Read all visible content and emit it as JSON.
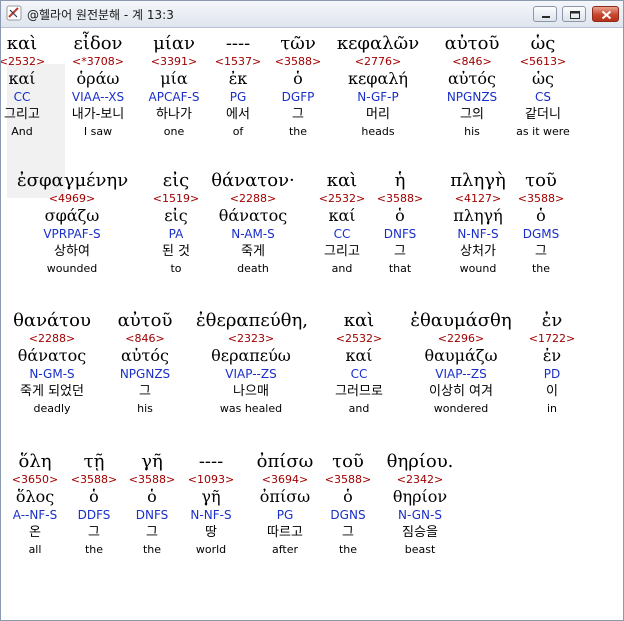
{
  "window": {
    "title": "@헬라어 원전분해 - 계 13:3"
  },
  "lines": [
    {
      "words": [
        {
          "greek": "καὶ",
          "strong": "<2532>",
          "lexeme": "καί",
          "parse": "CC",
          "korean": "그리고",
          "english": "And"
        },
        {
          "greek": "εἶδον",
          "strong": "<*3708>",
          "lexeme": "ὁράω",
          "parse": "VIAA--XS",
          "korean": "내가-보니",
          "english": "I saw"
        },
        {
          "greek": "μίαν",
          "strong": "<3391>",
          "lexeme": "μία",
          "parse": "APCAF-S",
          "korean": "하나가",
          "english": "one"
        },
        {
          "greek": "----",
          "strong": "<1537>",
          "lexeme": "ἐκ",
          "parse": "PG",
          "korean": "에서",
          "english": "of"
        },
        {
          "greek": "τῶν",
          "strong": "<3588>",
          "lexeme": "ὁ",
          "parse": "DGFP",
          "korean": "그",
          "english": "the"
        },
        {
          "greek": "κεφαλῶν",
          "strong": "<2776>",
          "lexeme": "κεφαλή",
          "parse": "N-GF-P",
          "korean": "머리",
          "english": "heads"
        },
        {
          "greek": "αὐτοῦ",
          "strong": "<846>",
          "lexeme": "αὐτός",
          "parse": "NPGNZS",
          "korean": "그의",
          "english": "his"
        },
        {
          "greek": "ὡς",
          "strong": "<5613>",
          "lexeme": "ὡς",
          "parse": "CS",
          "korean": "같더니",
          "english": "as it were"
        }
      ]
    },
    {
      "words": [
        {
          "greek": "ἐσφαγμένην",
          "strong": "<4969>",
          "lexeme": "σφάζω",
          "parse": "VPRPAF-S",
          "korean": "상하여",
          "english": "wounded"
        },
        {
          "greek": "εἰς",
          "strong": "<1519>",
          "lexeme": "εἰς",
          "parse": "PA",
          "korean": "된 것",
          "english": "to"
        },
        {
          "greek": "θάνατον·",
          "strong": "<2288>",
          "lexeme": "θάνατος",
          "parse": "N-AM-S",
          "korean": "죽게",
          "english": "death"
        },
        {
          "greek": "καὶ",
          "strong": "<2532>",
          "lexeme": "καί",
          "parse": "CC",
          "korean": "그리고",
          "english": "and"
        },
        {
          "greek": "ἡ",
          "strong": "<3588>",
          "lexeme": "ὁ",
          "parse": "DNFS",
          "korean": "그",
          "english": "that"
        },
        {
          "greek": "πληγὴ",
          "strong": "<4127>",
          "lexeme": "πληγή",
          "parse": "N-NF-S",
          "korean": "상처가",
          "english": "wound"
        },
        {
          "greek": "τοῦ",
          "strong": "<3588>",
          "lexeme": "ὁ",
          "parse": "DGMS",
          "korean": "그",
          "english": "the"
        }
      ]
    },
    {
      "words": [
        {
          "greek": "θανάτου",
          "strong": "<2288>",
          "lexeme": "θάνατος",
          "parse": "N-GM-S",
          "korean": "죽게 되었던",
          "english": "deadly"
        },
        {
          "greek": "αὐτοῦ",
          "strong": "<846>",
          "lexeme": "αὐτός",
          "parse": "NPGNZS",
          "korean": "그",
          "english": "his"
        },
        {
          "greek": "ἐθεραπεύθη,",
          "strong": "<2323>",
          "lexeme": "θεραπεύω",
          "parse": "VIAP--ZS",
          "korean": "나으매",
          "english": "was healed"
        },
        {
          "greek": "καὶ",
          "strong": "<2532>",
          "lexeme": "καί",
          "parse": "CC",
          "korean": "그러므로",
          "english": "and"
        },
        {
          "greek": "ἐθαυμάσθη",
          "strong": "<2296>",
          "lexeme": "θαυμάζω",
          "parse": "VIAP--ZS",
          "korean": "이상히 여겨",
          "english": "wondered"
        },
        {
          "greek": "ἐν",
          "strong": "<1722>",
          "lexeme": "ἐν",
          "parse": "PD",
          "korean": "이",
          "english": "in"
        }
      ]
    },
    {
      "words": [
        {
          "greek": "ὅλη",
          "strong": "<3650>",
          "lexeme": "ὅλος",
          "parse": "A--NF-S",
          "korean": "온",
          "english": "all"
        },
        {
          "greek": "τῇ",
          "strong": "<3588>",
          "lexeme": "ὁ",
          "parse": "DDFS",
          "korean": "그",
          "english": "the"
        },
        {
          "greek": "γῆ",
          "strong": "<3588>",
          "lexeme": "ὁ",
          "parse": "DNFS",
          "korean": "그",
          "english": "the"
        },
        {
          "greek": "----",
          "strong": "<1093>",
          "lexeme": "γῆ",
          "parse": "N-NF-S",
          "korean": "땅",
          "english": "world"
        },
        {
          "greek": "ὀπίσω",
          "strong": "<3694>",
          "lexeme": "ὀπίσω",
          "parse": "PG",
          "korean": "따르고",
          "english": "after"
        },
        {
          "greek": "τοῦ",
          "strong": "<3588>",
          "lexeme": "ὁ",
          "parse": "DGNS",
          "korean": "그",
          "english": "the"
        },
        {
          "greek": "θηρίου.",
          "strong": "<2342>",
          "lexeme": "θηρίον",
          "parse": "N-GN-S",
          "korean": "짐승을",
          "english": "beast"
        }
      ]
    }
  ]
}
